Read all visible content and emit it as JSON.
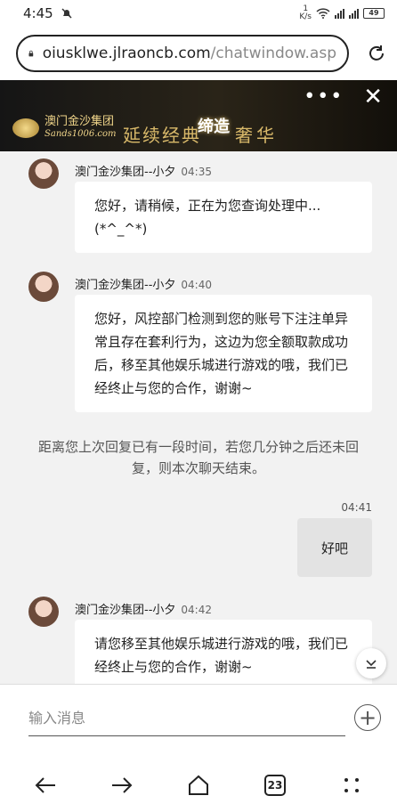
{
  "status": {
    "time": "4:45",
    "net_speed": "1",
    "net_unit": "K/s",
    "battery": "49"
  },
  "browser": {
    "url_host": "oiusklwe.jlraoncb.com",
    "url_path": "/chatwindow.asp",
    "tab_count": "23"
  },
  "banner": {
    "brand_cn": "澳门金沙集团",
    "brand_en": "Sands1006.com",
    "slogan_a": "延续经典",
    "slogan_mid": "缔造",
    "slogan_b": "奢华"
  },
  "messages": [
    {
      "sender": "澳门金沙集团--小夕",
      "time": "04:35",
      "text": "您好，请稍候，正在为您查询处理中...(*^_^*)"
    },
    {
      "sender": "澳门金沙集团--小夕",
      "time": "04:40",
      "text": "您好，风控部门检测到您的账号下注注单异常且存在套利行为，这边为您全额取款成功后，移至其他娱乐城进行游戏的哦，我们已经终止与您的合作，谢谢~"
    },
    {
      "sender": "澳门金沙集团--小夕",
      "time": "04:42",
      "text": "请您移至其他娱乐城进行游戏的哦，我们已经终止与您的合作，谢谢~"
    }
  ],
  "system_notice": "距离您上次回复已有一段时间，若您几分钟之后还未回复，则本次聊天结束。",
  "my_message": {
    "time": "04:41",
    "text": "好吧"
  },
  "composer": {
    "placeholder": "输入消息"
  }
}
